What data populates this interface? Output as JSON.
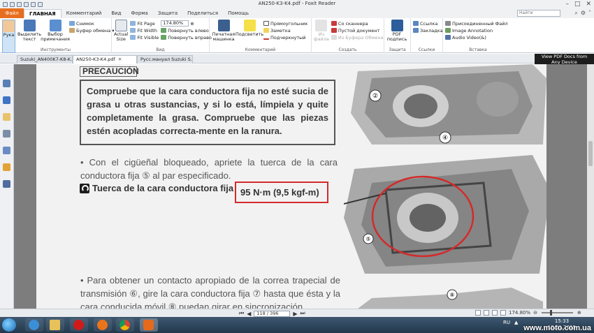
{
  "window": {
    "title": "AN250-K3-K4.pdf - Foxit Reader"
  },
  "ribbon_tabs": {
    "file": "Файл",
    "items": [
      "ГЛАВНАЯ",
      "Комментарий",
      "Вид",
      "Форма",
      "Защита",
      "Поделиться",
      "Помощь"
    ],
    "search_placeholder": "Найти"
  },
  "ribbon": {
    "tools": {
      "hand": "Рука",
      "select_text": "Выделить текст",
      "select_annot": "Выбор примечания",
      "snapshot": "Снимок",
      "clipboard": "Буфер обмена ▾",
      "label": "Инструменты"
    },
    "view": {
      "actual_size": "Actual Size",
      "fit_page": "Fit Page",
      "fit_width": "Fit Width",
      "fit_visible": "Fit Visible",
      "zoom": "174.80%",
      "rotate_left": "Повернуть влево",
      "rotate_right": "Повернуть вправо",
      "label": "Вид"
    },
    "comment": {
      "typewriter": "Печатная машинка",
      "highlight": "Подсветить",
      "rectangle": "Прямоугольник",
      "note": "Заметка",
      "underline": "Подчеркнутый",
      "label": "Комментарий"
    },
    "create": {
      "from_file": "Из файла",
      "from_scanner": "Со сканнера",
      "blank": "Пустой документ",
      "from_clipboard": "Из Буфера Обмена",
      "label": "Создать"
    },
    "protect": {
      "sign": "PDF подпись",
      "label": "Защита"
    },
    "links": {
      "link": "Ссылка",
      "bookmark": "Закладка",
      "label": "Ссылки"
    },
    "insert": {
      "attach": "Присоединенный Файл",
      "image": "Image Annotation",
      "audio": "Audio Video(&)",
      "label": "Вставка"
    }
  },
  "doc_tabs": [
    {
      "title": "Suzuki_AN400K7-K8-K..."
    },
    {
      "title": "AN250-K3-K4.pdf"
    },
    {
      "title": "Русс.мануал Suzuki S..."
    }
  ],
  "ad": {
    "line1": "View PDF Docs from",
    "line2": "Any Device"
  },
  "document": {
    "precaution_title": "PRECAUCIÓN",
    "precaution_text": "Compruebe que la cara conductora fija no esté sucia de grasa u otras sustancias, y si lo está, límpiela y quite completamente la grasa. Compruebe que las piezas estén acopladas correcta-mente en la ranura.",
    "bullet1": "• Con el cigüeñal bloqueado, apriete la tuerca de la cara conductora fija ⑤ al par especificado.",
    "torque_label": "Tuerca de la cara conductora fija",
    "torque_value": "95 N·m (9,5 kgf-m)",
    "bullet2": "• Para obtener un contacto apropiado de la correa trapecial de transmisión ⑥, gire la cara conductora fija ⑦ hasta que ésta y la cara conducida móvil ⑧ puedan girar en sincronización.",
    "callouts": [
      "②",
      "④",
      "⑤",
      "⑧"
    ]
  },
  "status": {
    "page": "118 / 396",
    "zoom": "174.80%"
  },
  "taskbar": {
    "lang": "RU",
    "time": "15:33",
    "date": "15.01.2015"
  },
  "watermark": "www.moto.com.ua"
}
